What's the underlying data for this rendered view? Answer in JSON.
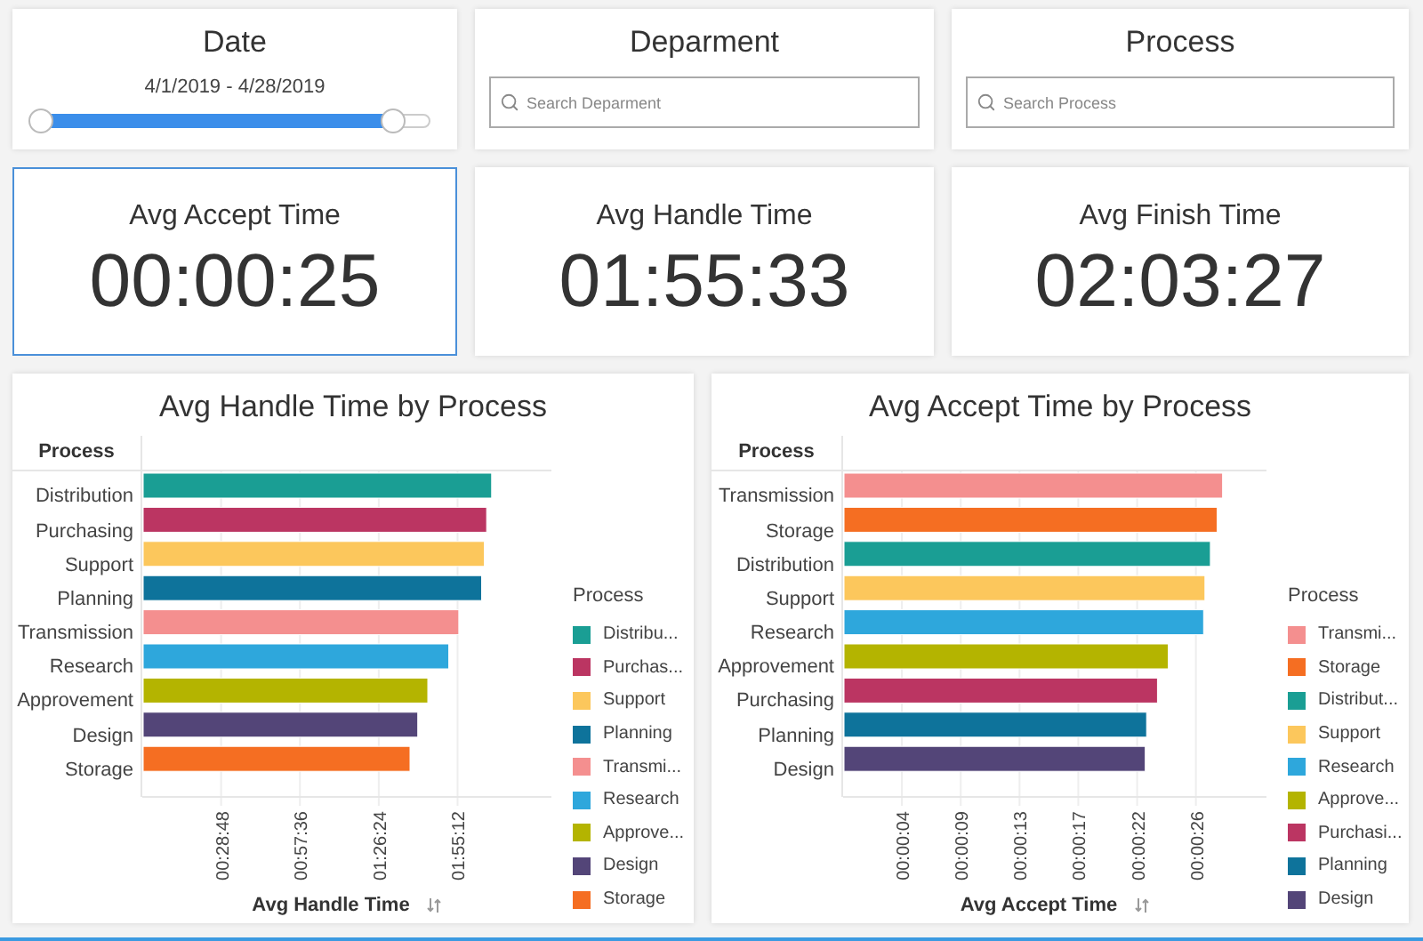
{
  "filters": [
    {
      "kind": "slider",
      "title": "Date",
      "range_label": "4/1/2019 - 4/28/2019",
      "thumbs": [
        {
          "level": 0
        },
        {
          "level": 0.91
        }
      ]
    },
    {
      "kind": "search",
      "title": "Deparment",
      "placeholder": "Search Deparment"
    },
    {
      "kind": "search",
      "title": "Process",
      "placeholder": "Search Process"
    }
  ],
  "kpis": [
    {
      "label": "Avg Accept Time",
      "value": "00:00:25",
      "selected": true
    },
    {
      "label": "Avg Handle Time",
      "value": "01:55:33",
      "selected": false
    },
    {
      "label": "Avg Finish Time",
      "value": "02:03:27",
      "selected": false
    }
  ],
  "charts": [
    {
      "chart_data": {
        "type": "bar",
        "orientation": "horizontal",
        "title": "Avg Handle Time by Process",
        "ylabel": "Process",
        "xlabel": "Avg Handle Time",
        "categories": [
          "Distribution",
          "Purchasing",
          "Support",
          "Planning",
          "Transmission",
          "Research",
          "Approvement",
          "Design",
          "Storage"
        ],
        "series": [
          {
            "values": [
              7640,
              7530,
              7480,
              7420,
              6920,
              6700,
              6240,
              6020,
              5850
            ]
          }
        ],
        "xlim": [
          0,
          8970
        ],
        "grid": true,
        "xticks": [
          {
            "value": 1728,
            "label": "00:28:48"
          },
          {
            "value": 3456,
            "label": "00:57:36"
          },
          {
            "value": 5184,
            "label": "01:26:24"
          },
          {
            "value": 6912,
            "label": "01:55:12"
          }
        ]
      },
      "legend": {
        "title": "Process",
        "items": [
          {
            "label": "Distribu...",
            "color": "#1a9e94"
          },
          {
            "label": "Purchas...",
            "color": "#bb3562"
          },
          {
            "label": "Support",
            "color": "#fcc75c"
          },
          {
            "label": "Planning",
            "color": "#0e739b"
          },
          {
            "label": "Transmi...",
            "color": "#f48f8f"
          },
          {
            "label": "Research",
            "color": "#2ea7dc"
          },
          {
            "label": "Approve...",
            "color": "#b4b400"
          },
          {
            "label": "Design",
            "color": "#534578"
          },
          {
            "label": "Storage",
            "color": "#f56e22"
          }
        ]
      }
    },
    {
      "chart_data": {
        "type": "bar",
        "orientation": "horizontal",
        "title": "Avg Accept Time by Process",
        "ylabel": "Process",
        "xlabel": "Avg Accept Time",
        "categories": [
          "Transmission",
          "Storage",
          "Distribution",
          "Support",
          "Research",
          "Approvement",
          "Purchasing",
          "Planning",
          "Design"
        ],
        "series": [
          {
            "values": [
              27.9,
              27.5,
              27.0,
              26.6,
              26.5,
              23.9,
              23.1,
              22.3,
              22.2
            ]
          }
        ],
        "xlim": [
          0,
          31.2
        ],
        "grid": true,
        "xticks": [
          {
            "value": 4.33,
            "label": "00:00:04"
          },
          {
            "value": 8.67,
            "label": "00:00:09"
          },
          {
            "value": 13,
            "label": "00:00:13"
          },
          {
            "value": 17.33,
            "label": "00:00:17"
          },
          {
            "value": 21.67,
            "label": "00:00:22"
          },
          {
            "value": 26,
            "label": "00:00:26"
          }
        ]
      },
      "legend": {
        "title": "Process",
        "items": [
          {
            "label": "Transmi...",
            "color": "#f48f8f"
          },
          {
            "label": "Storage",
            "color": "#f56e22"
          },
          {
            "label": "Distribut...",
            "color": "#1a9e94"
          },
          {
            "label": "Support",
            "color": "#fcc75c"
          },
          {
            "label": "Research",
            "color": "#2ea7dc"
          },
          {
            "label": "Approve...",
            "color": "#b4b400"
          },
          {
            "label": "Purchasi...",
            "color": "#bb3562"
          },
          {
            "label": "Planning",
            "color": "#0e739b"
          },
          {
            "label": "Design",
            "color": "#534578"
          }
        ]
      }
    }
  ]
}
